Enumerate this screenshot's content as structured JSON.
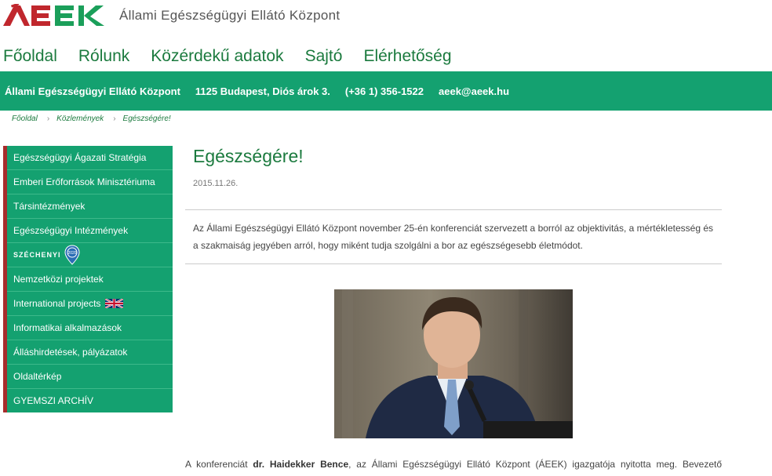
{
  "header": {
    "logo_text": "ÁEEK",
    "subtitle": "Állami Egészségügyi Ellátó Központ",
    "colors": {
      "logo_red": "#c0272d",
      "logo_green": "#1b9f5a"
    }
  },
  "topnav": {
    "items": [
      "Főoldal",
      "Rólunk",
      "Közérdekű adatok",
      "Sajtó",
      "Elérhetőség"
    ]
  },
  "infobar": {
    "name": "Állami Egészségügyi Ellátó Központ",
    "address": "1125 Budapest, Diós árok 3.",
    "phone": "(+36 1) 356-1522",
    "email": "aeek@aeek.hu",
    "color": "#14a170"
  },
  "breadcrumb": {
    "items": [
      "Főoldal",
      "Közlemények",
      "Egészségére!"
    ]
  },
  "sidebar": {
    "items": [
      "Egészségügyi Ágazati Stratégia",
      "Emberi Erőforrások Minisztériuma",
      "Társintézmények",
      "Egészségügyi Intézmények",
      "SZÉCHENYI",
      "Nemzetközi projektek",
      "International projects",
      "Informatikai alkalmazások",
      "Álláshirdetések, pályázatok",
      "Oldaltérkép",
      "GYEMSZI ARCHÍV"
    ],
    "szechenyi_badge": "2020",
    "accent": "#a82c2c"
  },
  "article": {
    "title": "Egészségére!",
    "date": "2015.11.26.",
    "lead": "Az Állami Egészségügyi Ellátó Központ november 25-én konferenciát szervezett a borról az objektivitás, a mértékletesség és a szakmaiság jegyében arról, hogy miként tudja szolgálni a bor az egészségesebb életmódot.",
    "body_prefix": "A konferenciát ",
    "body_name": "dr. Haidekker Bence",
    "body_suffix": ", az Állami Egészségügyi Ellátó Központ (ÁEEK) igazgatója nyitotta meg. Bevezető szavaiban ismertette, hogy Magyarország elsősorban mezőgazdasági termékeket előállító ország, ezért nem mindegy, hogy"
  }
}
